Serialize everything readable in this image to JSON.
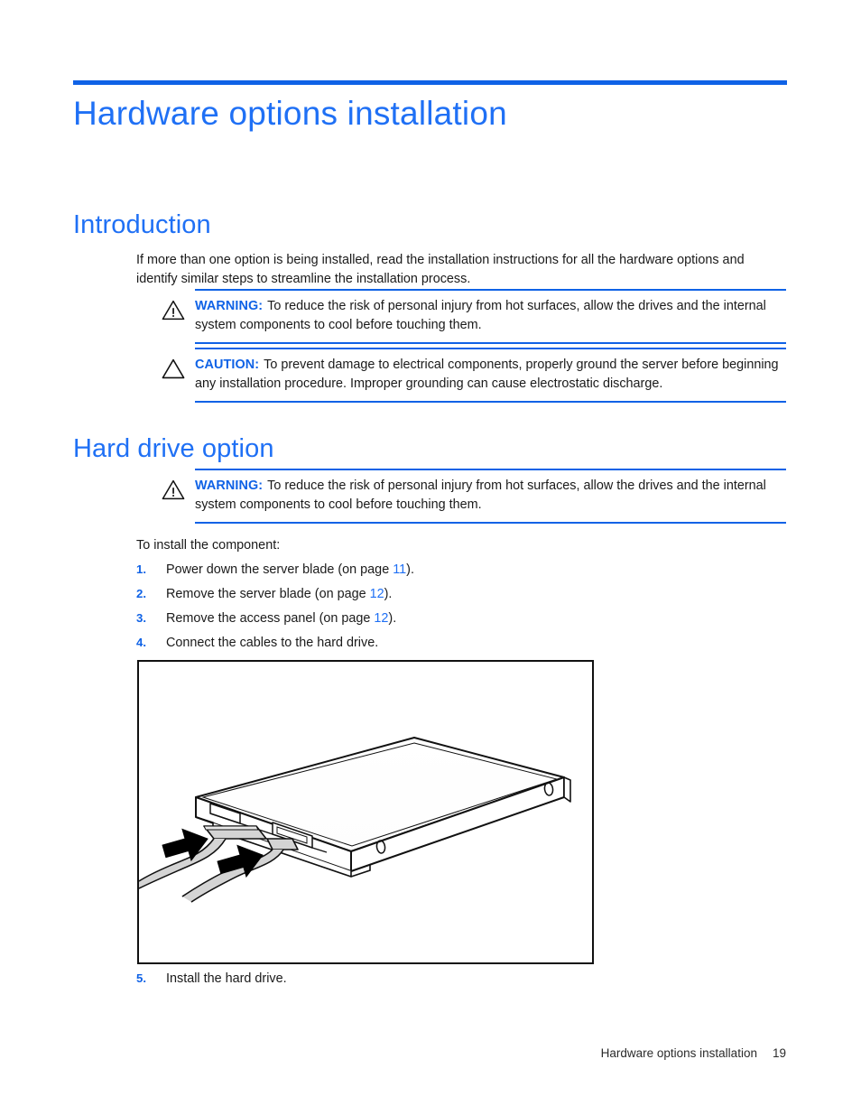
{
  "meta": {
    "accent_blue": "#0f62e6",
    "heading_blue": "#1f70f5",
    "body_black": "#1a1a1a"
  },
  "chapter": {
    "title": "Hardware options installation"
  },
  "sections": {
    "introduction": {
      "heading": "Introduction",
      "paragraph": "If more than one option is being installed, read the installation instructions for all the hardware options and identify similar steps to streamline the installation process.",
      "admonitions": [
        {
          "type": "warning",
          "icon": "warning-triangle-icon",
          "label": "WARNING:",
          "text": "To reduce the risk of personal injury from hot surfaces, allow the drives and the internal system components to cool before touching them."
        },
        {
          "type": "caution",
          "icon": "caution-triangle-icon",
          "label": "CAUTION:",
          "text": "To prevent damage to electrical components, properly ground the server before beginning any installation procedure. Improper grounding can cause electrostatic discharge."
        }
      ]
    },
    "hard_drive_option": {
      "heading": "Hard drive option",
      "admonitions": [
        {
          "type": "warning",
          "icon": "warning-triangle-icon",
          "label": "WARNING:",
          "text": "To reduce the risk of personal injury from hot surfaces, allow the drives and the internal system components to cool before touching them."
        }
      ],
      "intro_line": "To install the component:",
      "steps": [
        {
          "number": "1.",
          "text_before": "Power down the server blade (on page ",
          "xref": "11",
          "text_after": ")."
        },
        {
          "number": "2.",
          "text_before": "Remove the server blade (on page ",
          "xref": "12",
          "text_after": ")."
        },
        {
          "number": "3.",
          "text_before": "Remove the access panel (on page ",
          "xref": "12",
          "text_after": ")."
        },
        {
          "number": "4.",
          "text_before": "Connect the cables to the hard drive.",
          "xref": "",
          "text_after": ""
        }
      ],
      "figure": {
        "name": "hard-drive-cable-connection-illustration",
        "description": "Line drawing of a hard drive with two cables being connected, indicated by two black arrows"
      },
      "steps_after_figure": [
        {
          "number": "5.",
          "text_before": "Install the hard drive.",
          "xref": "",
          "text_after": ""
        }
      ]
    }
  },
  "footer": {
    "title": "Hardware options installation",
    "page_number": "19"
  }
}
